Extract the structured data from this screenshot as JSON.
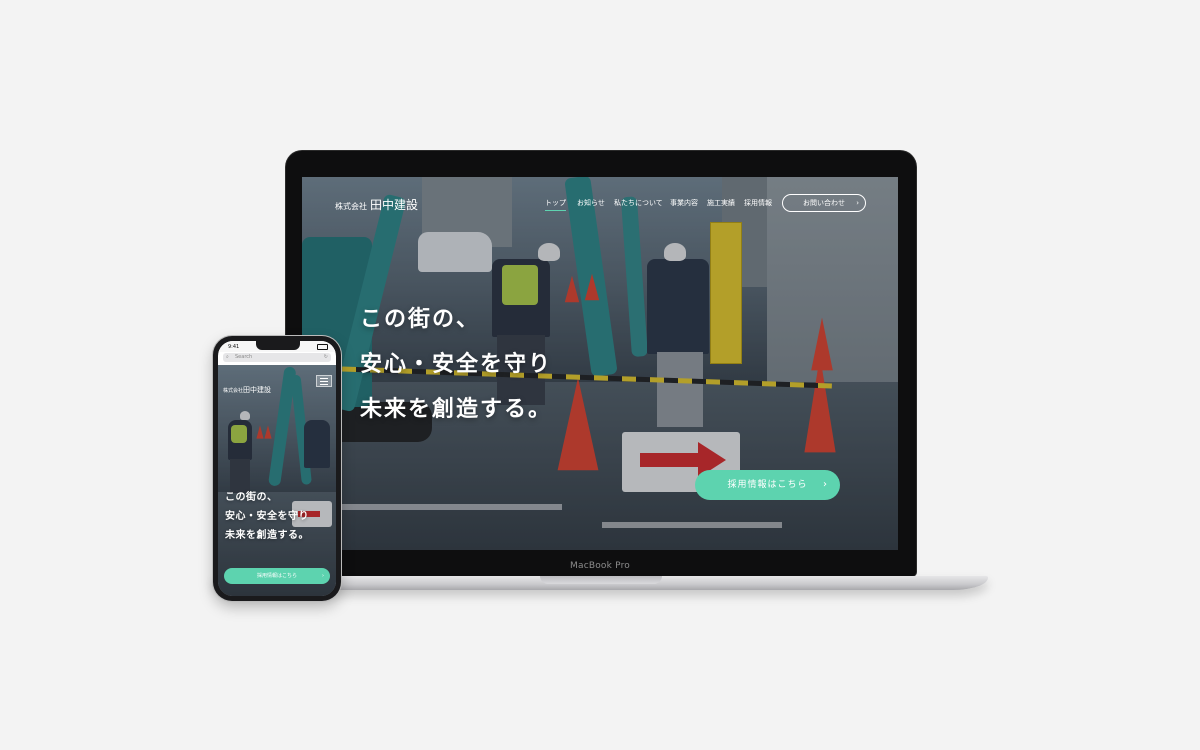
{
  "laptop": {
    "model_label": "MacBook Pro",
    "site": {
      "logo_small": "株式会社",
      "logo_big": "田中建設",
      "nav": [
        "トップ",
        "お知らせ",
        "私たちについて",
        "事業内容",
        "施工実績",
        "採用情報"
      ],
      "contact_label": "お問い合わせ",
      "hero_lines": [
        "この街の、",
        "安心・安全を守り",
        "未来を創造する。"
      ],
      "cta_label": "採用情報はこちら",
      "chevron": "›",
      "accent_color": "#5dd3af"
    }
  },
  "phone": {
    "status_time": "9:41",
    "search_placeholder": "Search",
    "logo_small": "株式会社",
    "logo_big": "田中建設",
    "hero_lines": [
      "この街の、",
      "安心・安全を守り",
      "未来を創造する。"
    ],
    "cta_label": "採用情報はこちら",
    "chevron": "›"
  }
}
